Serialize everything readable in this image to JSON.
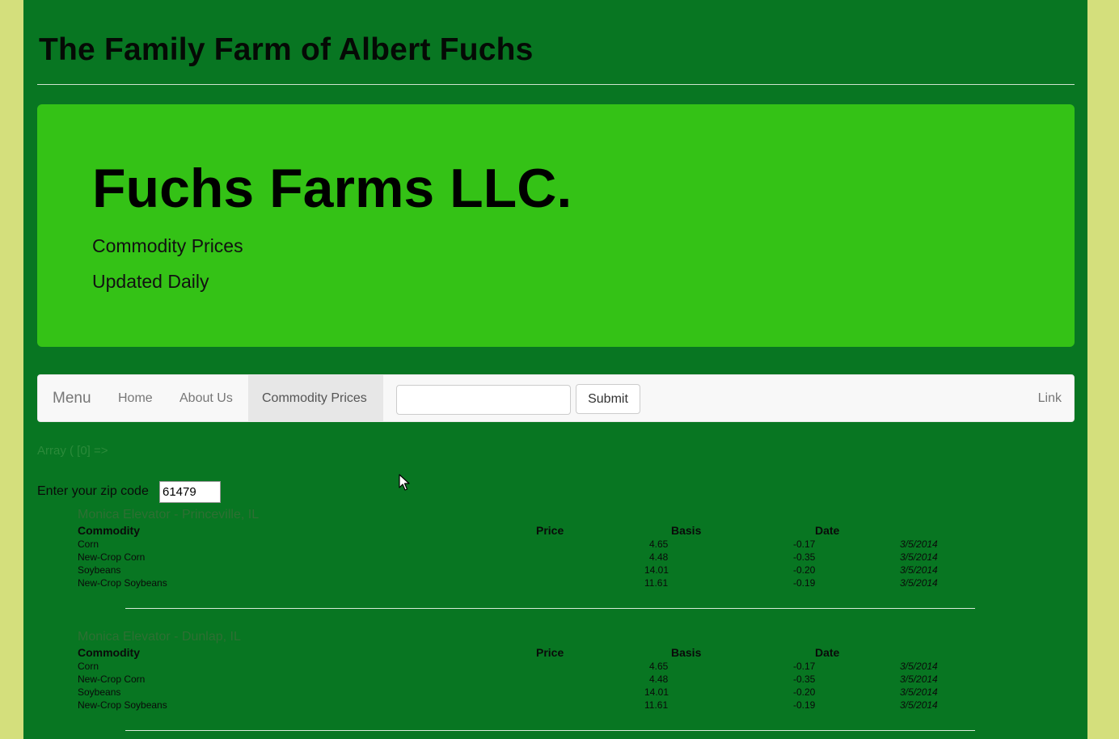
{
  "site": {
    "title": "The Family Farm of Albert Fuchs"
  },
  "jumbotron": {
    "heading": "Fuchs Farms LLC.",
    "line1": "Commodity Prices",
    "line2": "Updated Daily"
  },
  "navbar": {
    "brand": "Menu",
    "items": [
      {
        "label": "Home"
      },
      {
        "label": "About Us"
      },
      {
        "label": "Commodity Prices",
        "active": true
      }
    ],
    "search_value": "",
    "submit_label": "Submit",
    "right_link": "Link"
  },
  "debug_text": "Array ( [0] =>",
  "zip": {
    "label": "Enter your zip code",
    "value": "61479"
  },
  "table_headers": [
    "Commodity",
    "Price",
    "Basis",
    "Date"
  ],
  "elevators": [
    {
      "name": "Monica Elevator - Princeville, IL",
      "rows": [
        {
          "commodity": "Corn",
          "price": "4.65",
          "basis": "-0.17",
          "date": "3/5/2014"
        },
        {
          "commodity": "New-Crop Corn",
          "price": "4.48",
          "basis": "-0.35",
          "date": "3/5/2014"
        },
        {
          "commodity": "Soybeans",
          "price": "14.01",
          "basis": "-0.20",
          "date": "3/5/2014"
        },
        {
          "commodity": "New-Crop Soybeans",
          "price": "11.61",
          "basis": "-0.19",
          "date": "3/5/2014"
        }
      ]
    },
    {
      "name": "Monica Elevator - Dunlap, IL",
      "rows": [
        {
          "commodity": "Corn",
          "price": "4.65",
          "basis": "-0.17",
          "date": "3/5/2014"
        },
        {
          "commodity": "New-Crop Corn",
          "price": "4.48",
          "basis": "-0.35",
          "date": "3/5/2014"
        },
        {
          "commodity": "Soybeans",
          "price": "14.01",
          "basis": "-0.20",
          "date": "3/5/2014"
        },
        {
          "commodity": "New-Crop Soybeans",
          "price": "11.61",
          "basis": "-0.19",
          "date": "3/5/2014"
        }
      ]
    }
  ],
  "colors": {
    "outer_background": "#d4df7c",
    "page_background": "#087622",
    "jumbotron_background": "#34c216"
  }
}
